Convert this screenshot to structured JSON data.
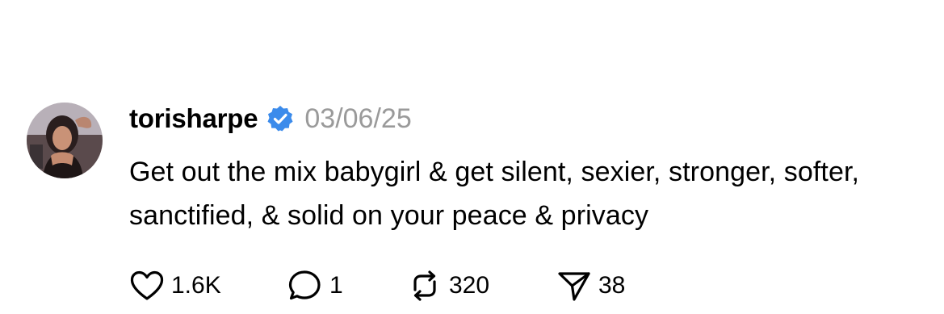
{
  "post": {
    "username": "torisharpe",
    "verified": true,
    "date": "03/06/25",
    "text": "Get out the mix babygirl & get silent, sexier, stronger, softer, sanctified, & solid on your peace & privacy",
    "avatar_icon": "profile-photo",
    "verified_icon": "verified-badge-icon",
    "accent_color": "#3b8beb"
  },
  "actions": {
    "likes": "1.6K",
    "replies": "1",
    "reposts": "320",
    "shares": "38",
    "icons": [
      "heart-icon",
      "comment-icon",
      "repost-icon",
      "send-icon"
    ]
  }
}
